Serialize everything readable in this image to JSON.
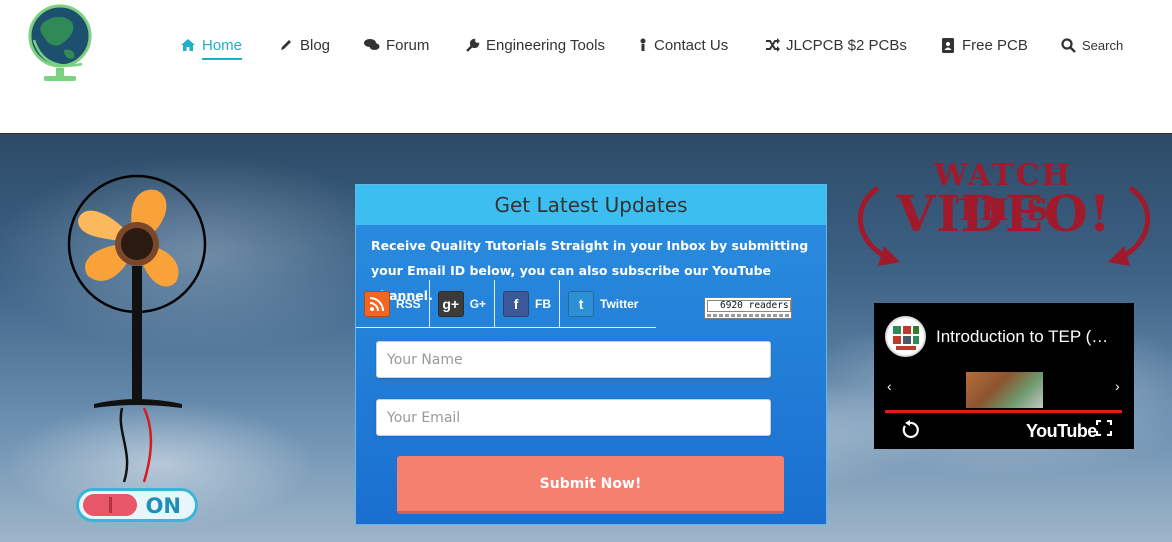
{
  "nav": {
    "items": [
      {
        "label": "Home",
        "icon": "home-icon",
        "active": true
      },
      {
        "label": "Blog",
        "icon": "pencil-icon"
      },
      {
        "label": "Forum",
        "icon": "comments-icon"
      },
      {
        "label": "Engineering Tools",
        "icon": "wrench-icon"
      },
      {
        "label": "Contact Us",
        "icon": "person-icon"
      },
      {
        "label": "JLCPCB $2 PCBs",
        "icon": "shuffle-icon"
      },
      {
        "label": "Free PCB",
        "icon": "address-book-icon"
      },
      {
        "label": "Search",
        "icon": "search-icon"
      }
    ],
    "accent_color": "#1fb0c8"
  },
  "hero": {
    "toggle_label": "ON"
  },
  "subscribe": {
    "title": "Get Latest Updates",
    "description": "Receive Quality Tutorials Straight in your Inbox by submitting your Email ID below, you can also subscribe our YouTube Channel.",
    "social": [
      {
        "label": "RSS",
        "icon": "rss-icon",
        "color": "#f26522"
      },
      {
        "label": "G+",
        "icon": "google-plus-icon",
        "color": "#3b3b3b"
      },
      {
        "label": "FB",
        "icon": "facebook-icon",
        "color": "#3b5998"
      },
      {
        "label": "Twitter",
        "icon": "twitter-icon",
        "color": "#2d8fd5"
      }
    ],
    "readers_count": "6920 readers",
    "name_placeholder": "Your Name",
    "email_placeholder": "Your Email",
    "submit_label": "Submit Now!",
    "submit_color": "#f58070"
  },
  "watch": {
    "line1": "WATCH THIS",
    "line2": "VIDEO!",
    "color": "#a01a2c"
  },
  "video": {
    "title": "Introduction to TEP (…",
    "brand": "YouTube"
  }
}
